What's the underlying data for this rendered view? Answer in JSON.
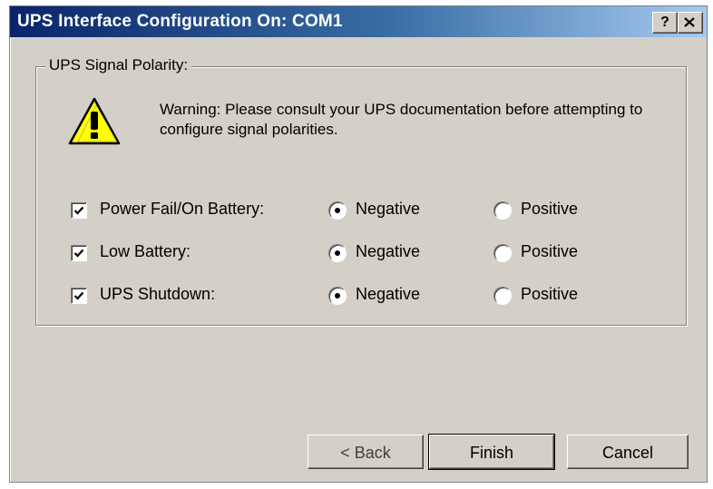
{
  "window": {
    "title": "UPS Interface Configuration On: COM1",
    "help_label": "?"
  },
  "group": {
    "label": "UPS Signal Polarity:",
    "warning": "Warning: Please consult your UPS documentation before attempting to configure signal polarities."
  },
  "signals": [
    {
      "label": "Power Fail/On Battery:",
      "checked": true,
      "polarity": "Negative"
    },
    {
      "label": "Low Battery:",
      "checked": true,
      "polarity": "Negative"
    },
    {
      "label": "UPS Shutdown:",
      "checked": true,
      "polarity": "Negative"
    }
  ],
  "options": {
    "negative": "Negative",
    "positive": "Positive"
  },
  "buttons": {
    "back": "< Back",
    "finish": "Finish",
    "cancel": "Cancel"
  }
}
